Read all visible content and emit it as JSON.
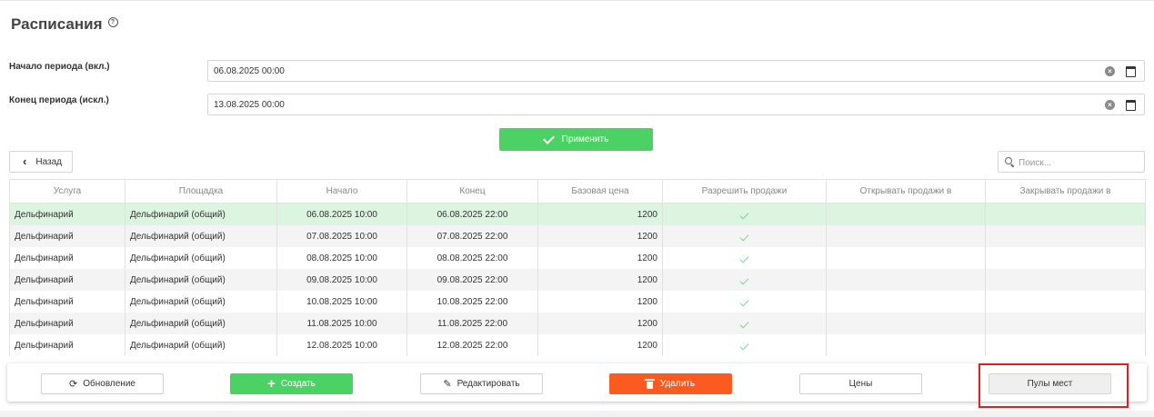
{
  "page": {
    "title": "Расписания"
  },
  "filters": {
    "start_label": "Начало периода (вкл.)",
    "start_value": "06.08.2025 00:00",
    "end_label": "Конец периода (искл.)",
    "end_value": "13.08.2025 00:00",
    "apply_label": "Применить"
  },
  "nav": {
    "back_label": "Назад"
  },
  "search": {
    "placeholder": "Поиск..."
  },
  "table": {
    "columns": [
      "Услуга",
      "Площадка",
      "Начало",
      "Конец",
      "Базовая цена",
      "Разрешить продажи",
      "Открывать продажи в",
      "Закрывать продажи в"
    ],
    "rows": [
      {
        "service": "Дельфинарий",
        "venue": "Дельфинарий (общий)",
        "start": "06.08.2025 10:00",
        "end": "06.08.2025 22:00",
        "price": "1200",
        "allow_sales": true,
        "open_at": "",
        "close_at": ""
      },
      {
        "service": "Дельфинарий",
        "venue": "Дельфинарий (общий)",
        "start": "07.08.2025 10:00",
        "end": "07.08.2025 22:00",
        "price": "1200",
        "allow_sales": true,
        "open_at": "",
        "close_at": ""
      },
      {
        "service": "Дельфинарий",
        "venue": "Дельфинарий (общий)",
        "start": "08.08.2025 10:00",
        "end": "08.08.2025 22:00",
        "price": "1200",
        "allow_sales": true,
        "open_at": "",
        "close_at": ""
      },
      {
        "service": "Дельфинарий",
        "venue": "Дельфинарий (общий)",
        "start": "09.08.2025 10:00",
        "end": "09.08.2025 22:00",
        "price": "1200",
        "allow_sales": true,
        "open_at": "",
        "close_at": ""
      },
      {
        "service": "Дельфинарий",
        "venue": "Дельфинарий (общий)",
        "start": "10.08.2025 10:00",
        "end": "10.08.2025 22:00",
        "price": "1200",
        "allow_sales": true,
        "open_at": "",
        "close_at": ""
      },
      {
        "service": "Дельфинарий",
        "venue": "Дельфинарий (общий)",
        "start": "11.08.2025 10:00",
        "end": "11.08.2025 22:00",
        "price": "1200",
        "allow_sales": true,
        "open_at": "",
        "close_at": ""
      },
      {
        "service": "Дельфинарий",
        "venue": "Дельфинарий (общий)",
        "start": "12.08.2025 10:00",
        "end": "12.08.2025 22:00",
        "price": "1200",
        "allow_sales": true,
        "open_at": "",
        "close_at": ""
      }
    ]
  },
  "toolbar": {
    "refresh_label": "Обновление",
    "create_label": "Создать",
    "edit_label": "Редактировать",
    "delete_label": "Удалить",
    "prices_label": "Цены",
    "pools_label": "Пулы мест"
  },
  "colors": {
    "accent_green": "#4cd264",
    "danger_orange": "#fb5b21",
    "selected_row": "#dbf5e0",
    "highlight_red": "#e02020"
  }
}
